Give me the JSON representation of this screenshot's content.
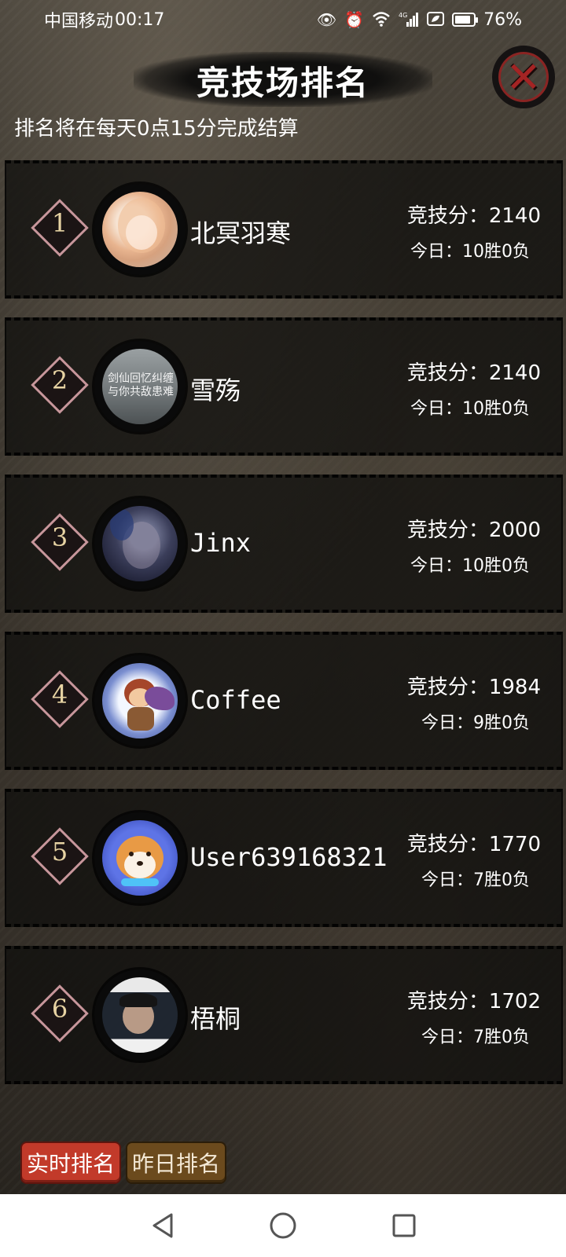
{
  "status_bar": {
    "carrier": "中国移动",
    "time": "00:17",
    "signal_label": "4G",
    "battery": "76%",
    "icons": [
      "eye-icon",
      "alarm-icon",
      "wifi-icon",
      "signal-icon",
      "eco-icon",
      "battery-icon"
    ]
  },
  "header": {
    "title": "竞技场排名",
    "settle_note": "排名将在每天0点15分完成结算",
    "close_glyph": "✕"
  },
  "rankings": [
    {
      "rank": "1",
      "name": "北冥羽寒",
      "score": "竞技分：2140",
      "record": "今日：10胜0负"
    },
    {
      "rank": "2",
      "name": "雪殇",
      "score": "竞技分：2140",
      "record": "今日：10胜0负",
      "avatar_text": "剑仙回忆纠缠与你共敌患难"
    },
    {
      "rank": "3",
      "name": "Jinx",
      "score": "竞技分：2000",
      "record": "今日：10胜0负"
    },
    {
      "rank": "4",
      "name": "Coffee",
      "score": "竞技分：1984",
      "record": "今日：9胜0负"
    },
    {
      "rank": "5",
      "name": "User639168321",
      "score": "竞技分：1770",
      "record": "今日：7胜0负"
    },
    {
      "rank": "6",
      "name": "梧桐",
      "score": "竞技分：1702",
      "record": "今日：7胜0负"
    }
  ],
  "tabs": {
    "realtime": "实时排名",
    "yesterday": "昨日排名"
  },
  "colors": {
    "realtime_tab": "#c23a2a",
    "yesterday_tab": "#6b4a1d",
    "rank_badge_border": "#c7969b",
    "rank_number": "#e7d3a3",
    "close_x": "#a42424"
  }
}
